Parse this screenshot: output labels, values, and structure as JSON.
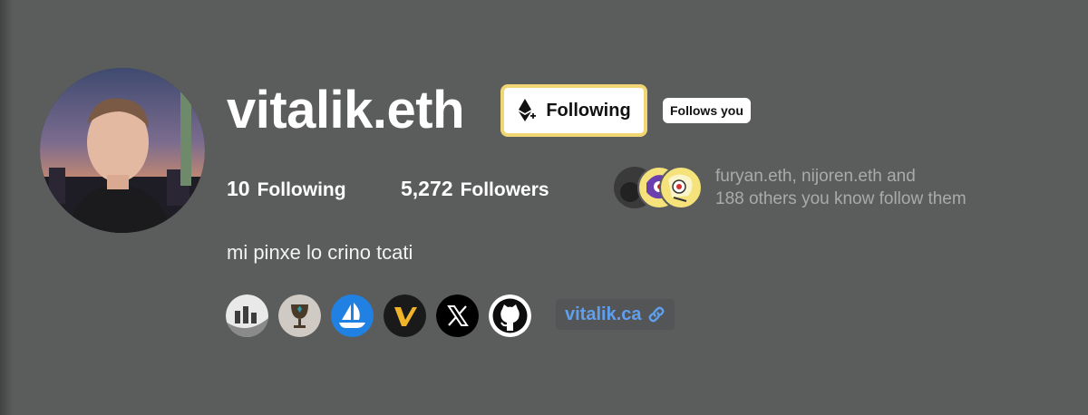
{
  "profile": {
    "name": "vitalik.eth",
    "bio": "mi pinxe lo crino tcati",
    "avatar_icon": "profile-photo"
  },
  "follow_button": {
    "label": "Following",
    "icon": "ethereum-plus-icon",
    "border_color": "#f0d774"
  },
  "follows_you_badge": "Follows you",
  "stats": {
    "following_count": "10",
    "following_label": "Following",
    "followers_count": "5,272",
    "followers_label": "Followers"
  },
  "mutuals": {
    "line1": "furyan.eth, nijoren.eth and",
    "line2": "188 others you know follow them"
  },
  "social_links": [
    {
      "icon": "chart-logo-icon"
    },
    {
      "icon": "goblet-icon"
    },
    {
      "icon": "opensea-icon",
      "color": "#2081e2"
    },
    {
      "icon": "v-logo-icon"
    },
    {
      "icon": "x-icon"
    },
    {
      "icon": "github-icon"
    }
  ],
  "website": {
    "label": "vitalik.ca",
    "icon": "link-icon",
    "color": "#5ea0ef"
  },
  "colors": {
    "background": "#5b5c5c",
    "text": "#ffffff",
    "muted": "#a9aaab"
  }
}
